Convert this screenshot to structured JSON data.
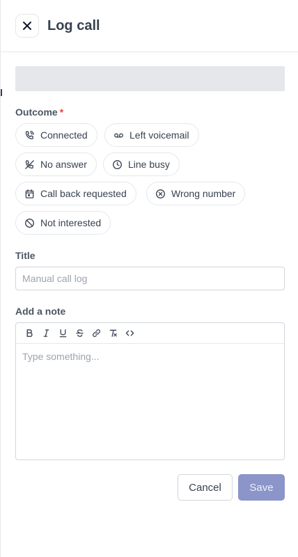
{
  "header": {
    "title": "Log call",
    "close_icon": "close-icon"
  },
  "outcome": {
    "label": "Outcome",
    "required_mark": "*",
    "options": [
      {
        "label": "Connected",
        "icon": "phone-connected-icon"
      },
      {
        "label": "Left voicemail",
        "icon": "voicemail-icon"
      },
      {
        "label": "No answer",
        "icon": "phone-missed-icon"
      },
      {
        "label": "Line busy",
        "icon": "clock-icon"
      },
      {
        "label": "Call back requested",
        "icon": "calendar-icon"
      },
      {
        "label": "Wrong number",
        "icon": "x-circle-icon"
      },
      {
        "label": "Not interested",
        "icon": "ban-icon"
      }
    ]
  },
  "title_field": {
    "label": "Title",
    "value": "",
    "placeholder": "Manual call log"
  },
  "note": {
    "label": "Add a note",
    "placeholder": "Type something...",
    "toolbar": [
      "bold-icon",
      "italic-icon",
      "underline-icon",
      "strikethrough-icon",
      "link-icon",
      "clear-format-icon",
      "code-icon"
    ]
  },
  "actions": {
    "cancel_label": "Cancel",
    "save_label": "Save"
  },
  "colors": {
    "accent": "#8b95c9",
    "required": "#ef4444",
    "border": "#e5e7eb"
  }
}
